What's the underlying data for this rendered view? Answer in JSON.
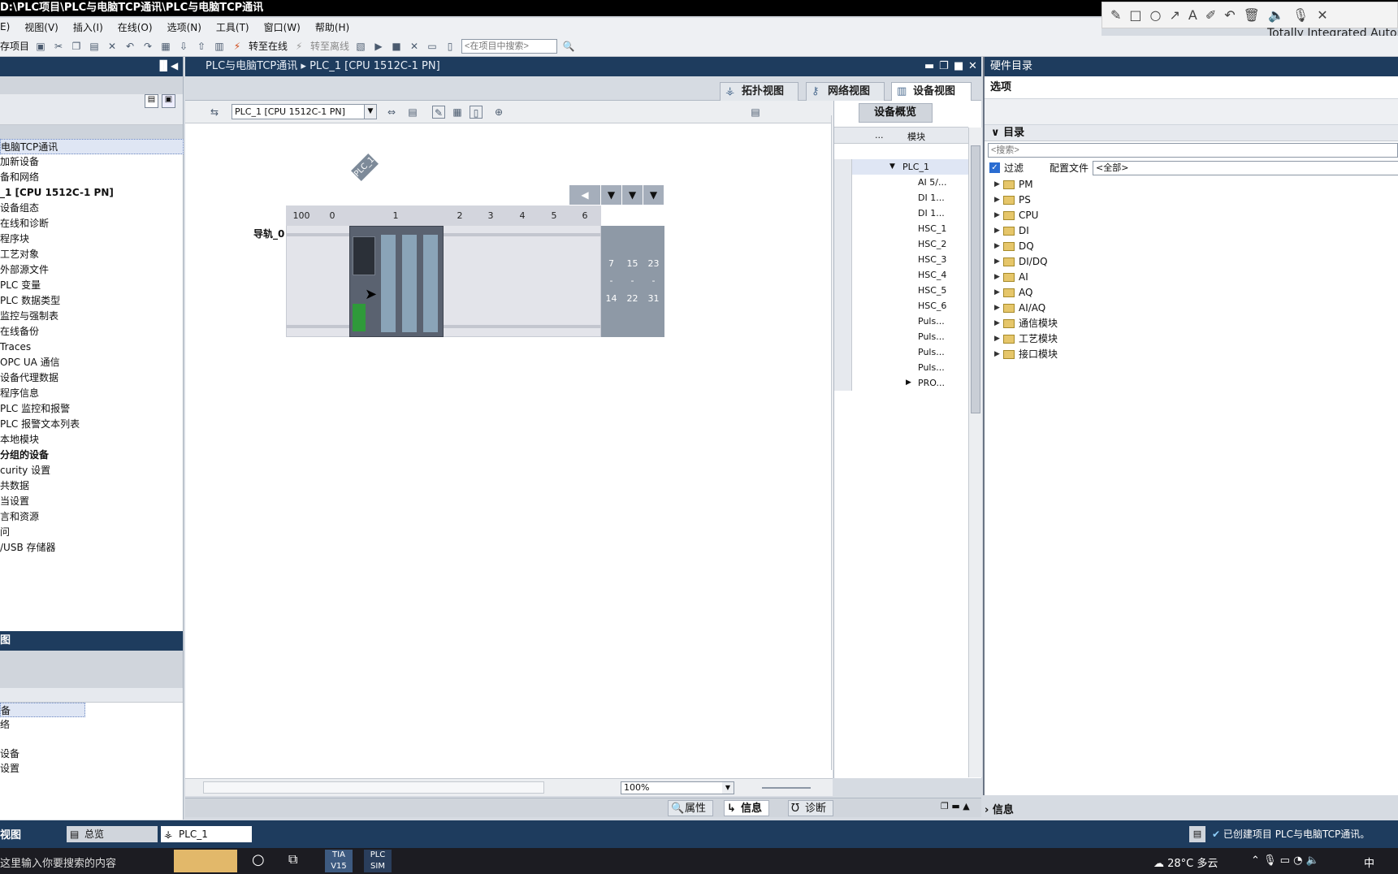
{
  "titlebar": {
    "title": "D:\\PLC项目\\PLC与电脑TCP通讯\\PLC与电脑TCP通讯"
  },
  "brand": {
    "text": "Totally Integrated Autom"
  },
  "menu": [
    "E)",
    "视图(V)",
    "插入(I)",
    "在线(O)",
    "选项(N)",
    "工具(T)",
    "窗口(W)",
    "帮助(H)"
  ],
  "toolbar": {
    "save_label": "存项目",
    "go_online": "转至在线",
    "go_offline": "转至离线",
    "search_placeholder": "<在项目中搜索>"
  },
  "project_tree": {
    "items": [
      {
        "label": "电脑TCP通讯",
        "sel": true
      },
      {
        "label": "加新设备"
      },
      {
        "label": "备和网络"
      },
      {
        "label": "_1 [CPU 1512C-1 PN]",
        "bold": true
      },
      {
        "label": "设备组态"
      },
      {
        "label": "在线和诊断"
      },
      {
        "label": "程序块"
      },
      {
        "label": "工艺对象"
      },
      {
        "label": "外部源文件"
      },
      {
        "label": "PLC 变量"
      },
      {
        "label": "PLC 数据类型"
      },
      {
        "label": "监控与强制表"
      },
      {
        "label": "在线备份"
      },
      {
        "label": "Traces"
      },
      {
        "label": "OPC UA 通信"
      },
      {
        "label": "设备代理数据"
      },
      {
        "label": "程序信息"
      },
      {
        "label": "PLC 监控和报警"
      },
      {
        "label": "PLC 报警文本列表"
      },
      {
        "label": "本地模块"
      },
      {
        "label": "分组的设备",
        "bold": true
      },
      {
        "label": "curity 设置"
      },
      {
        "label": "共数据"
      },
      {
        "label": "当设置"
      },
      {
        "label": "言和资源"
      },
      {
        "label": "问"
      },
      {
        "label": "/USB 存储器"
      }
    ]
  },
  "details_view": {
    "title": "图",
    "items": [
      "备",
      "络",
      "",
      "设备",
      "设置"
    ]
  },
  "center": {
    "breadcrumb_project": "PLC与电脑TCP通讯",
    "breadcrumb_device": "PLC_1 [CPU 1512C-1 PN]",
    "tabs": [
      "拓扑视图",
      "网络视图",
      "设备视图"
    ],
    "device_select": "PLC_1 [CPU 1512C-1 PN]",
    "zoom": "100%"
  },
  "rack": {
    "device_label": "PLC_1",
    "rail_label": "导轨_0",
    "slots": [
      "100",
      "0",
      "1",
      "2",
      "3",
      "4",
      "5",
      "6"
    ],
    "ext_slots": [
      "...14",
      "...22",
      "...31"
    ],
    "ext_top": [
      "7",
      "15",
      "23"
    ],
    "ext_bottom": [
      "14",
      "22",
      "31"
    ],
    "dash": "-"
  },
  "device_overview": {
    "tab": "设备概览",
    "col_dots": "...",
    "col_module": "模块",
    "rows": [
      "PLC_1",
      "AI 5/...",
      "DI 1...",
      "DI 1...",
      "HSC_1",
      "HSC_2",
      "HSC_3",
      "HSC_4",
      "HSC_5",
      "HSC_6",
      "Puls...",
      "Puls...",
      "Puls...",
      "Puls...",
      "PRO..."
    ]
  },
  "hardware_catalog": {
    "title": "硬件目录",
    "options": "选项",
    "catalog": "目录",
    "search_placeholder": "<搜索>",
    "filter_label": "过滤",
    "profile_label": "配置文件",
    "profile_value": "<全部>",
    "categories": [
      "PM",
      "PS",
      "CPU",
      "DI",
      "DQ",
      "DI/DQ",
      "AI",
      "AQ",
      "AI/AQ",
      "通信模块",
      "工艺模块",
      "接口模块"
    ]
  },
  "inspector": {
    "properties": "属性",
    "info": "信息",
    "diagnostics": "诊断",
    "info_right": "信息"
  },
  "portal": {
    "view": "视图",
    "overview": "总览",
    "plc_tab": "PLC_1",
    "status": "已创建项目 PLC与电脑TCP通讯。"
  },
  "taskbar": {
    "search": "这里输入你要搜索的内容",
    "weather": "28°C 多云",
    "lang": "中",
    "tia": "TIA V15",
    "plcsim": "PLC SIM"
  }
}
